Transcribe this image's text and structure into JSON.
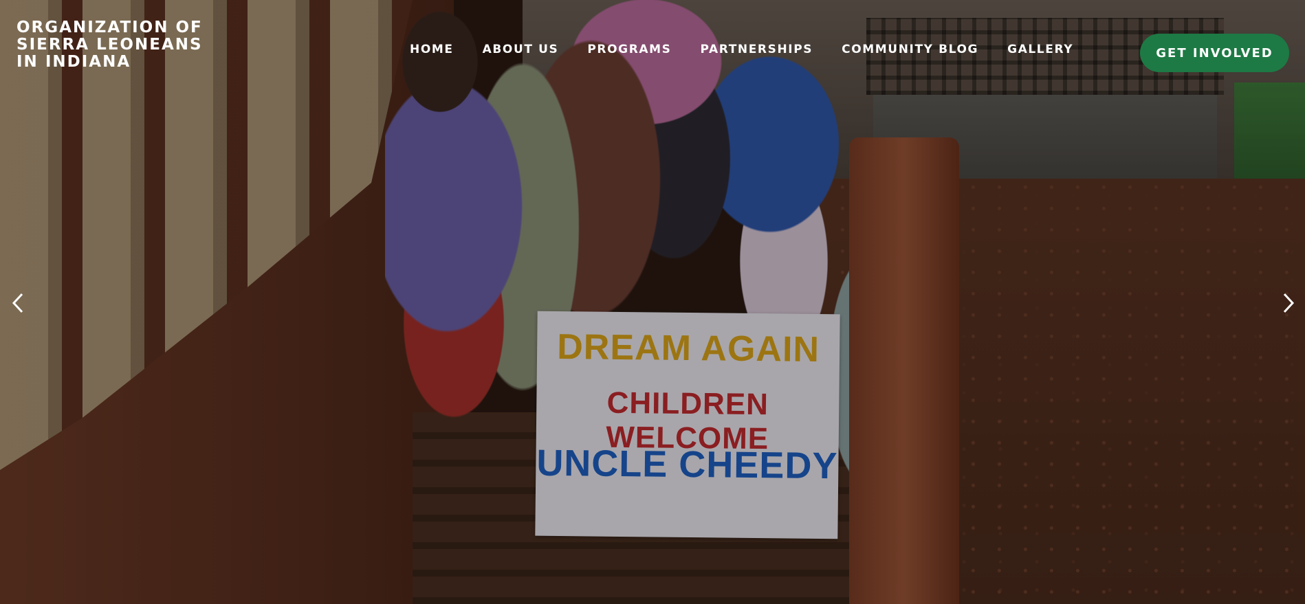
{
  "brand": {
    "name": "ORGANIZATION OF SIERRA LEONEANS IN INDIANA"
  },
  "nav": {
    "items": [
      {
        "label": "HOME"
      },
      {
        "label": "ABOUT US"
      },
      {
        "label": "PROGRAMS"
      },
      {
        "label": "PARTNERSHIPS"
      },
      {
        "label": "COMMUNITY BLOG"
      },
      {
        "label": "GALLERY"
      }
    ],
    "cta_label": "GET INVOLVED"
  },
  "hero": {
    "sign_lines": [
      "DREAM AGAIN",
      "CHILDREN WELCOME",
      "UNCLE CHEEDY"
    ],
    "prev_icon": "chevron-left-icon",
    "next_icon": "chevron-right-icon"
  },
  "colors": {
    "cta_background": "#1d7a44",
    "text": "#ffffff"
  }
}
